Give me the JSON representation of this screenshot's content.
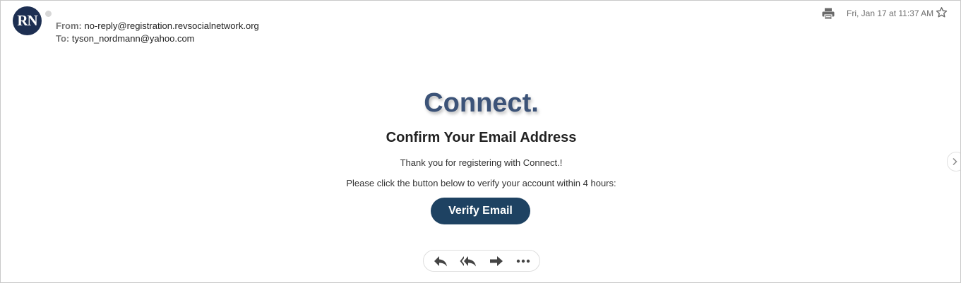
{
  "sender": {
    "avatar_initials": "RN",
    "avatar_color": "#1d2f52",
    "from_label": "From:",
    "from_address": "no-reply@registration.revsocialnetwork.org",
    "to_label": "To:",
    "to_address": "tyson_nordmann@yahoo.com"
  },
  "header_actions": {
    "timestamp": "Fri, Jan 17 at 11:37 AM",
    "print_icon": "print-icon",
    "star_icon": "star-icon"
  },
  "message": {
    "brand": "Connect.",
    "headline": "Confirm Your Email Address",
    "line1": "Thank you for registering with Connect.!",
    "line2": "Please click the button below to verify your account within 4 hours:",
    "button_label": "Verify Email",
    "button_color": "#1e4262",
    "brand_color": "#3c5378"
  },
  "toolbar": {
    "icons": [
      "reply-icon",
      "reply-all-icon",
      "forward-icon",
      "more-icon"
    ]
  },
  "navigation": {
    "next_icon": "chevron-right-icon"
  }
}
